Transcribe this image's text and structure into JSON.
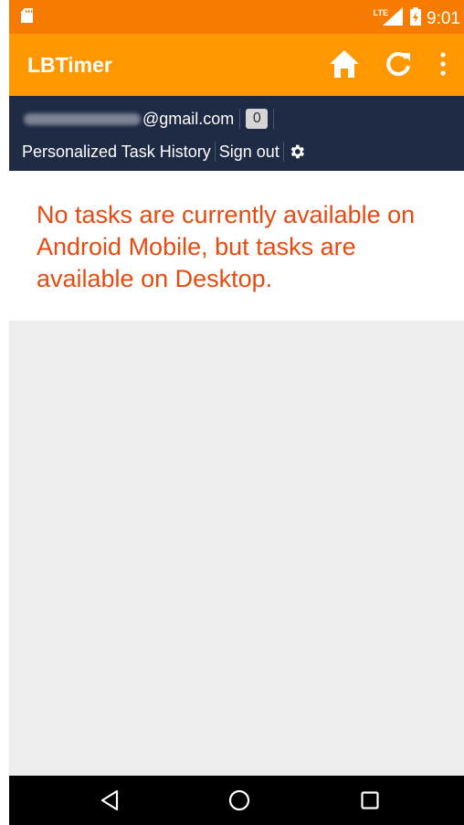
{
  "status_bar": {
    "time": "9:01",
    "network": "LTE",
    "icons": [
      "sd-card-icon",
      "signal-icon",
      "battery-icon"
    ]
  },
  "app_bar": {
    "title": "LBTimer",
    "actions": [
      "home-icon",
      "refresh-icon",
      "more-vert-icon"
    ]
  },
  "user_bar": {
    "email_suffix": "@gmail.com",
    "task_count": "0",
    "links": {
      "history": "Personalized Task History",
      "signout": "Sign out"
    },
    "settings_icon": "gear-icon"
  },
  "main": {
    "message": "No tasks are currently available on Android Mobile, but tasks are available on Desktop."
  },
  "nav_bar": {
    "buttons": [
      "back-icon",
      "home-circle-icon",
      "recents-icon"
    ]
  },
  "colors": {
    "status_bar": "#f57c00",
    "app_bar": "#ff9800",
    "user_bar": "#1f2a44",
    "message_text": "#e8490f",
    "background": "#eeeeee",
    "nav_bar": "#000000"
  }
}
